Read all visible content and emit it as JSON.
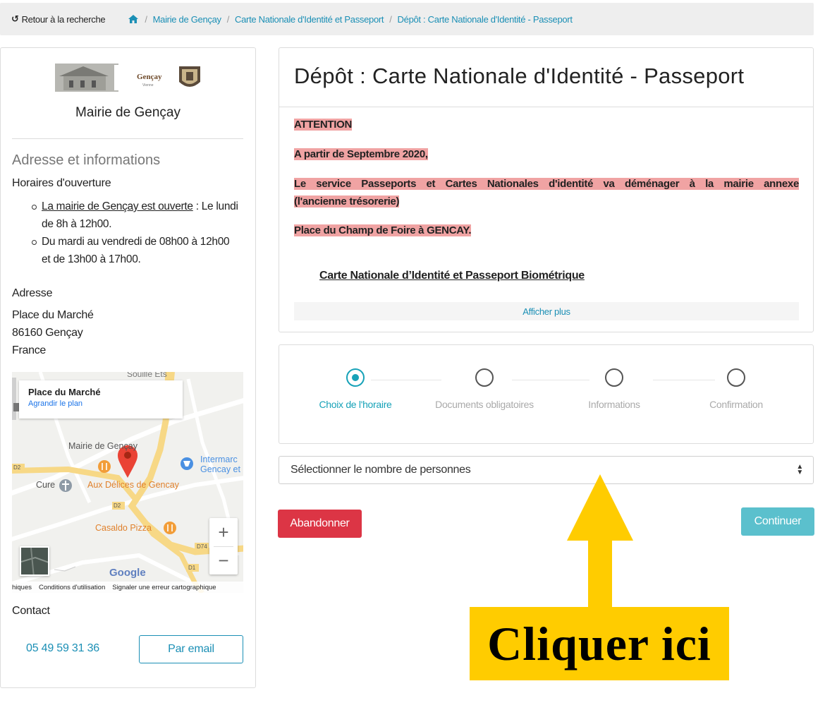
{
  "topbar": {
    "back_label": "Retour à la recherche",
    "breadcrumb": [
      "Mairie de Gençay",
      "Carte Nationale d'Identité et Passeport",
      "Dépôt : Carte Nationale d'Identité - Passeport"
    ]
  },
  "sidebar": {
    "logo_text": "Gençay",
    "logo_subtext": "Vienne",
    "mairie_name": "Mairie de Gençay",
    "section_title": "Adresse et informations",
    "hours_title": "Horaires d'ouverture",
    "hours": {
      "item1_link": "La mairie de Gençay est ouverte",
      "item1_rest": " : Le lundi de 8h à 12h00.",
      "item2": "Du mardi au vendredi de 08h00 à 12h00 et de 13h00 à 17h00."
    },
    "address_title": "Adresse",
    "address_lines": [
      "Place du Marché",
      "86160 Gençay",
      "France"
    ],
    "map": {
      "card_title": "Place du Marché",
      "card_link": "Agrandir le plan",
      "labels": {
        "top_street": "Souille Ets",
        "mairie": "Mairie de Gençay",
        "intermarche": "Intermarc",
        "intermarche2": "Gencay et",
        "cure": "Cure",
        "delices": "Aux Délices de Gencay",
        "casaldo": "Casaldo Pizza",
        "d2a": "D2",
        "d2b": "D2",
        "d1": "D1",
        "d741": "D74",
        "google": "Google"
      },
      "footer": [
        "hiques",
        "Conditions d'utilisation",
        "Signaler une erreur cartographique"
      ],
      "zoom_in": "+",
      "zoom_out": "−"
    },
    "contact_title": "Contact",
    "phone": "05 49 59 31 36",
    "email_label": "Par email"
  },
  "main": {
    "title": "Dépôt : Carte Nationale d'Identité - Passeport",
    "attention": "ATTENTION",
    "date_line": "A partir de Septembre 2020,",
    "move_line1": "Le service Passeports et Cartes Nationales d'identité va déménager à la mairie annexe",
    "move_line2": "(l'ancienne trésorerie)",
    "place_line": "Place du Champ de Foire à GENCAY.",
    "bio_link": "Carte Nationale d’Identité et Passeport Biométrique",
    "show_more": "Afficher plus"
  },
  "stepper": {
    "steps": [
      "Choix de l'horaire",
      "Documents obligatoires",
      "Informations",
      "Confirmation"
    ]
  },
  "form": {
    "select_placeholder": "Sélectionner le nombre de personnes",
    "cancel_label": "Abandonner",
    "continue_label": "Continuer"
  },
  "annotation": {
    "callout": "Cliquer ici"
  },
  "colors": {
    "link": "#1b8fb5",
    "danger": "#dc3545",
    "teal": "#5bc0cd",
    "highlight": "#f0a3a3",
    "callout": "#ffcc00"
  }
}
